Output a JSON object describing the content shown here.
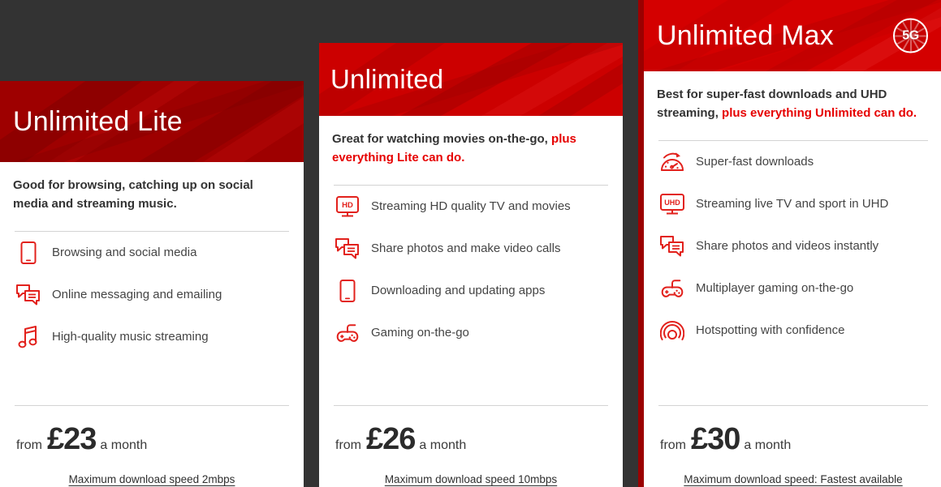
{
  "theme": {
    "page_background": "#333333",
    "card_background": "#ffffff",
    "accent_red": "#e60000",
    "icon_red": "#e2211c",
    "header_red_dark": "#9e0000",
    "header_red_mid": "#cc0000",
    "header_red_bright": "#d40000",
    "left_stripe_red": "#9b0000",
    "text_dark": "#333333",
    "text_body": "#444444",
    "divider": "#d3d3d3"
  },
  "cards": [
    {
      "id": "unlimited-lite",
      "title": "Unlimited Lite",
      "badge": null,
      "subtitle_plain": "Good for browsing, catching up on social media and streaming music.",
      "subtitle_emphasis": "",
      "features": [
        {
          "icon": "phone-icon",
          "label": "Browsing and social media"
        },
        {
          "icon": "chat-bubbles-icon",
          "label": "Online messaging and emailing"
        },
        {
          "icon": "music-note-icon",
          "label": "High-quality music streaming"
        }
      ],
      "price_from_label": "from",
      "price_amount": "£23",
      "price_period_label": "a month",
      "speed_link": "Maximum download speed 2mbps"
    },
    {
      "id": "unlimited",
      "title": "Unlimited",
      "badge": null,
      "subtitle_plain": "Great for watching movies on-the-go, ",
      "subtitle_emphasis": "plus everything Lite can do.",
      "features": [
        {
          "icon": "hd-tv-icon",
          "label": "Streaming HD quality TV and movies"
        },
        {
          "icon": "chat-bubbles-icon",
          "label": "Share photos and make video calls"
        },
        {
          "icon": "phone-icon",
          "label": "Downloading and updating apps"
        },
        {
          "icon": "gamepad-icon",
          "label": "Gaming on-the-go"
        }
      ],
      "price_from_label": "from",
      "price_amount": "£26",
      "price_period_label": "a month",
      "speed_link": "Maximum download speed 10mbps"
    },
    {
      "id": "unlimited-max",
      "title": "Unlimited Max",
      "badge": "5G",
      "subtitle_plain": "Best for super-fast downloads and UHD streaming, ",
      "subtitle_emphasis": "plus everything Unlimited can do.",
      "features": [
        {
          "icon": "speedometer-icon",
          "label": "Super-fast downloads"
        },
        {
          "icon": "uhd-tv-icon",
          "label": "Streaming live TV and sport in UHD"
        },
        {
          "icon": "chat-bubbles-icon",
          "label": "Share photos and videos instantly"
        },
        {
          "icon": "gamepad-icon",
          "label": "Multiplayer gaming on-the-go"
        },
        {
          "icon": "hotspot-icon",
          "label": "Hotspotting with confidence"
        }
      ],
      "price_from_label": "from",
      "price_amount": "£30",
      "price_period_label": "a month",
      "speed_link": "Maximum download speed: Fastest available"
    }
  ]
}
